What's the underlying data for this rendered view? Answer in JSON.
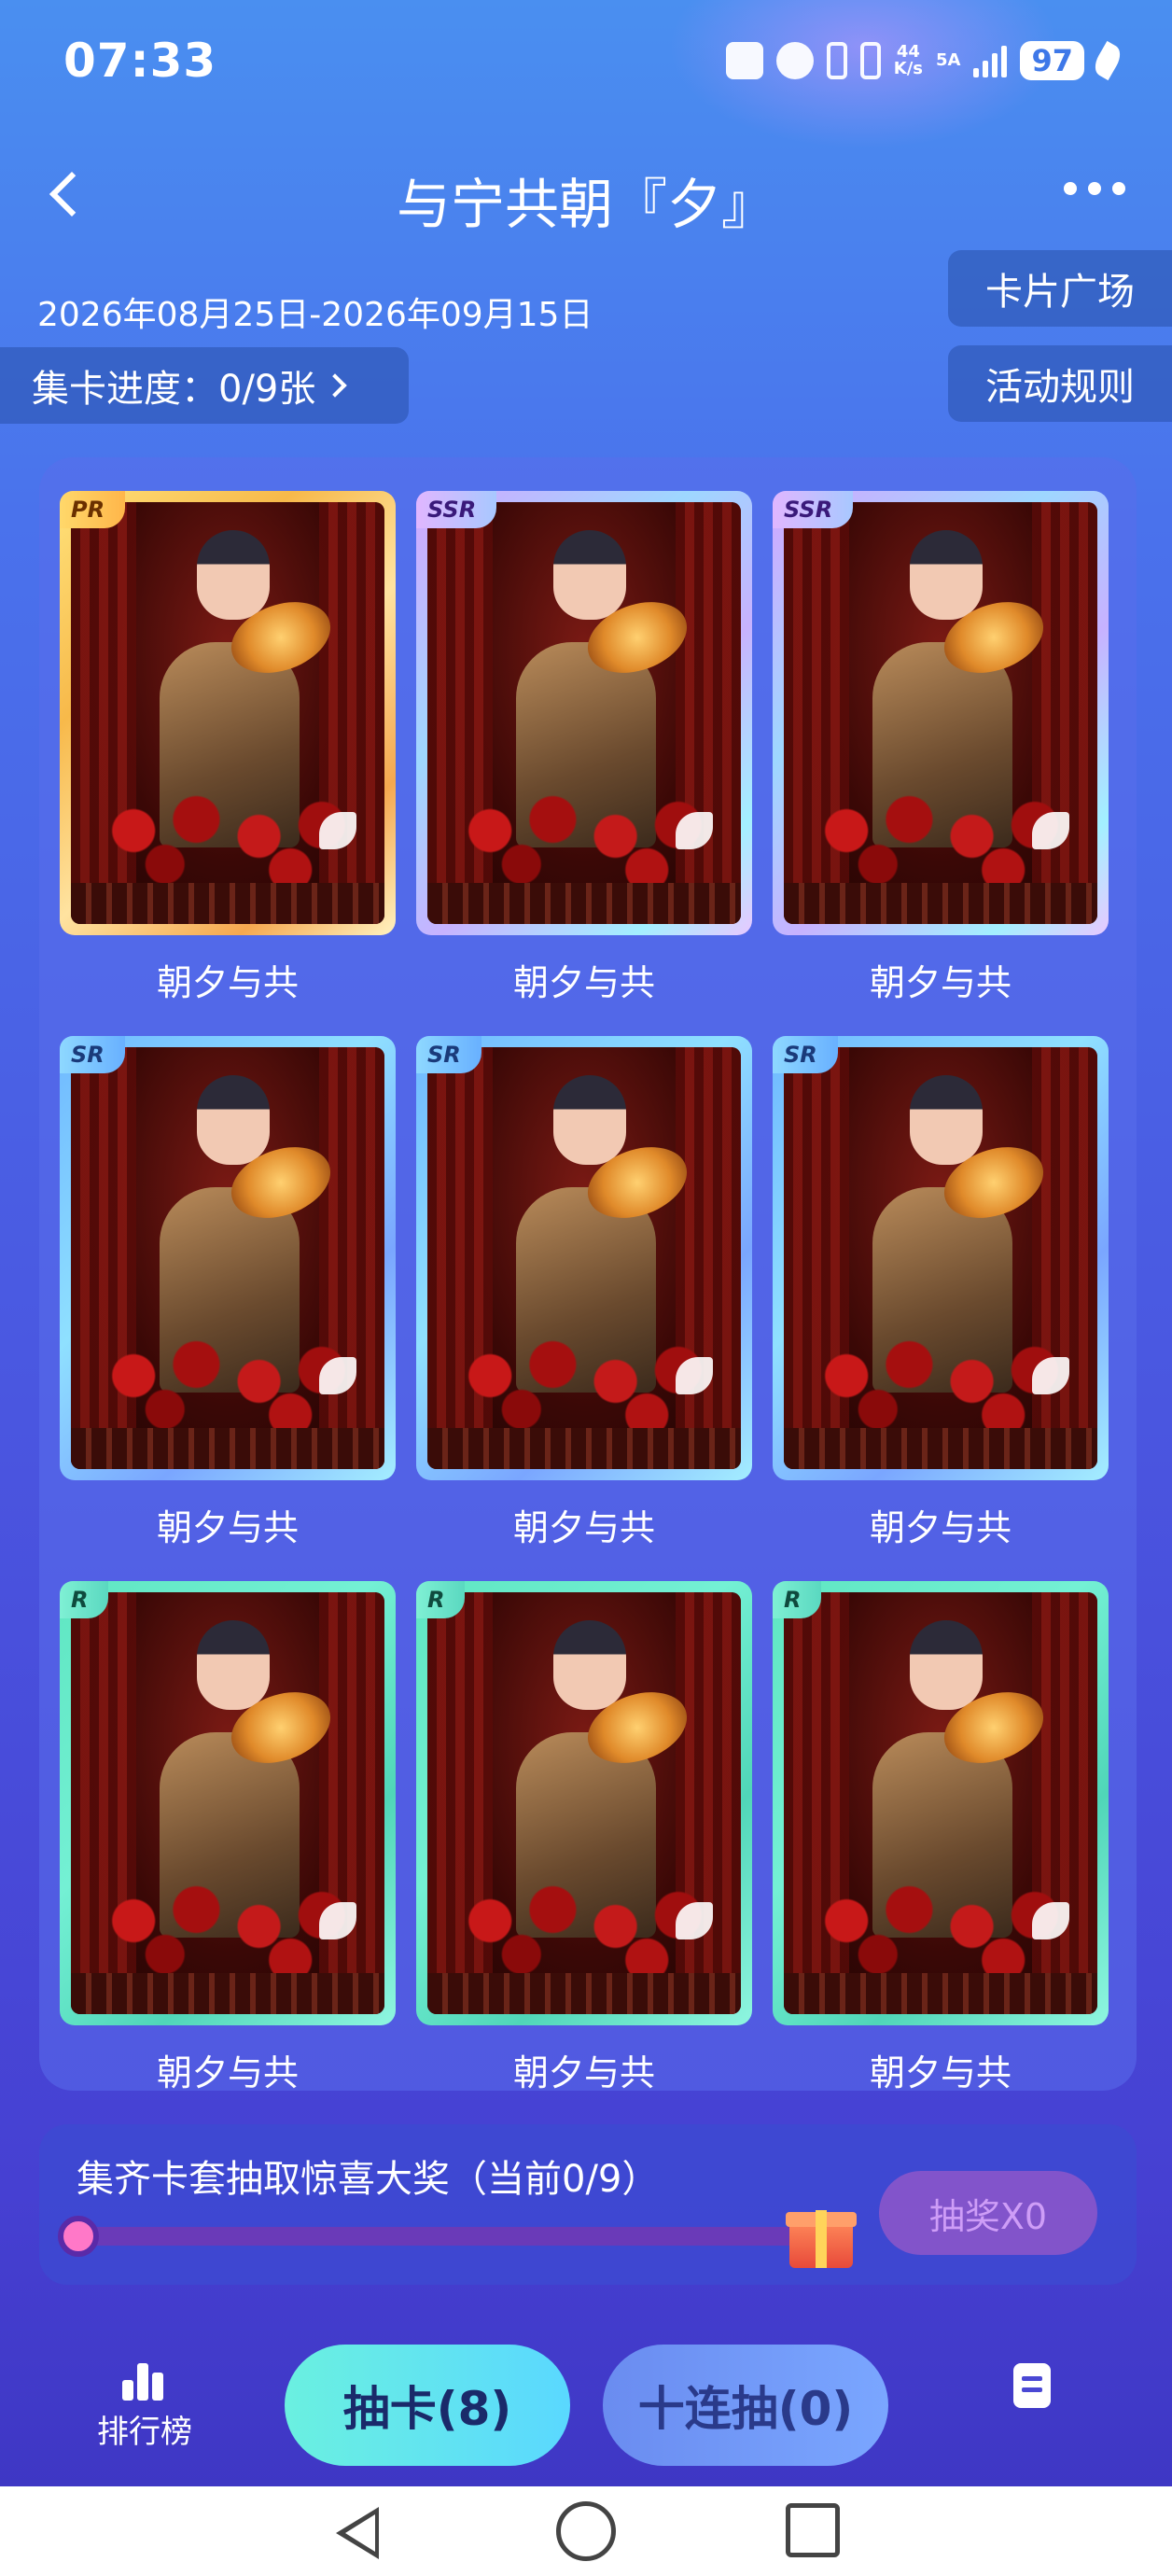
{
  "status_bar": {
    "time": "07:33",
    "net_speed_top": "44",
    "net_speed_bottom": "K/s",
    "signal_label": "5A",
    "battery": "97"
  },
  "header": {
    "title": "与宁共朝『夕』"
  },
  "event": {
    "date_range": "2026年08月25日-2026年09月15日",
    "progress_label": "集卡进度：0/9张",
    "card_plaza": "卡片广场",
    "rules": "活动规则"
  },
  "cards": [
    {
      "rarity": "PR",
      "name": "朝夕与共",
      "frame": "pr"
    },
    {
      "rarity": "SSR",
      "name": "朝夕与共",
      "frame": "ssr"
    },
    {
      "rarity": "SSR",
      "name": "朝夕与共",
      "frame": "ssr"
    },
    {
      "rarity": "SR",
      "name": "朝夕与共",
      "frame": "sr"
    },
    {
      "rarity": "SR",
      "name": "朝夕与共",
      "frame": "sr"
    },
    {
      "rarity": "SR",
      "name": "朝夕与共",
      "frame": "sr"
    },
    {
      "rarity": "R",
      "name": "朝夕与共",
      "frame": "r"
    },
    {
      "rarity": "R",
      "name": "朝夕与共",
      "frame": "r"
    },
    {
      "rarity": "R",
      "name": "朝夕与共",
      "frame": "r"
    }
  ],
  "prize": {
    "text": "集齐卡套抽取惊喜大奖（当前0/9）",
    "progress": 0,
    "lottery_button": "抽奖X0"
  },
  "actions": {
    "ranking": "排行榜",
    "draw": "抽卡(8)",
    "ten_draw": "十连抽(0)"
  },
  "colors": {
    "pr_frame": "#f7b94a",
    "ssr_frame": "#c7b2ff",
    "sr_frame": "#7aa6ff",
    "r_frame": "#5fe6c2",
    "draw_button": "#6af0e0"
  },
  "icons": [
    "back-icon",
    "more-icon",
    "chevron-right-icon",
    "gift-icon",
    "ranking-icon",
    "document-icon",
    "nav-back-icon",
    "nav-home-icon",
    "nav-recent-icon"
  ]
}
